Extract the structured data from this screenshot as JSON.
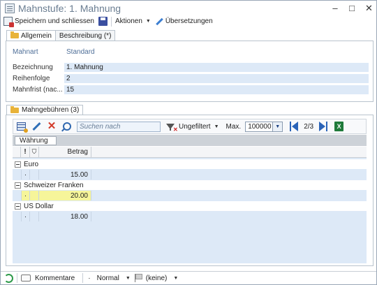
{
  "window": {
    "title": "Mahnstufe: 1. Mahnung",
    "controls": [
      "–",
      "□",
      "✕"
    ]
  },
  "toolbar": {
    "save_close_label": "Speichern und schliessen",
    "actions_label": "Aktionen",
    "translations_label": "Übersetzungen"
  },
  "tabs": [
    {
      "label": "Allgemein",
      "active": true
    },
    {
      "label": "Beschreibung (*)",
      "active": false
    }
  ],
  "form": {
    "mahnart": {
      "label": "Mahnart",
      "value": "Standard"
    },
    "bezeichnung": {
      "label": "Bezeichnung",
      "value": "1. Mahnung"
    },
    "reihenfolge": {
      "label": "Reihenfolge",
      "value": "2"
    },
    "mahnfrist": {
      "label": "Mahnfrist  (nac...",
      "value": "15"
    }
  },
  "fees": {
    "tab_label": "Mahngebühren (3)",
    "search_placeholder": "Suchen nach",
    "filter_label": "Ungefiltert",
    "max_label": "Max.",
    "max_value": "100000",
    "pager": "2/3",
    "group_by": "Währung",
    "columns": {
      "excl": "!",
      "filter": "",
      "amount": "Betrag"
    },
    "groups": [
      {
        "name": "Euro",
        "rows": [
          {
            "marker": "·",
            "amount": "15.00",
            "selected": false
          }
        ]
      },
      {
        "name": "Schweizer Franken",
        "rows": [
          {
            "marker": "·",
            "amount": "20.00",
            "selected": true
          }
        ]
      },
      {
        "name": "US Dollar",
        "rows": [
          {
            "marker": "·",
            "amount": "18.00",
            "selected": false
          }
        ]
      }
    ]
  },
  "statusbar": {
    "comments_label": "Kommentare",
    "priority_label": "Normal",
    "flag_label": "(keine)"
  },
  "colors": {
    "title": "#6a7d91",
    "field_shade": "#dde9f7",
    "selected_row": "#f6f59a",
    "accent_blue": "#2a63b8"
  }
}
